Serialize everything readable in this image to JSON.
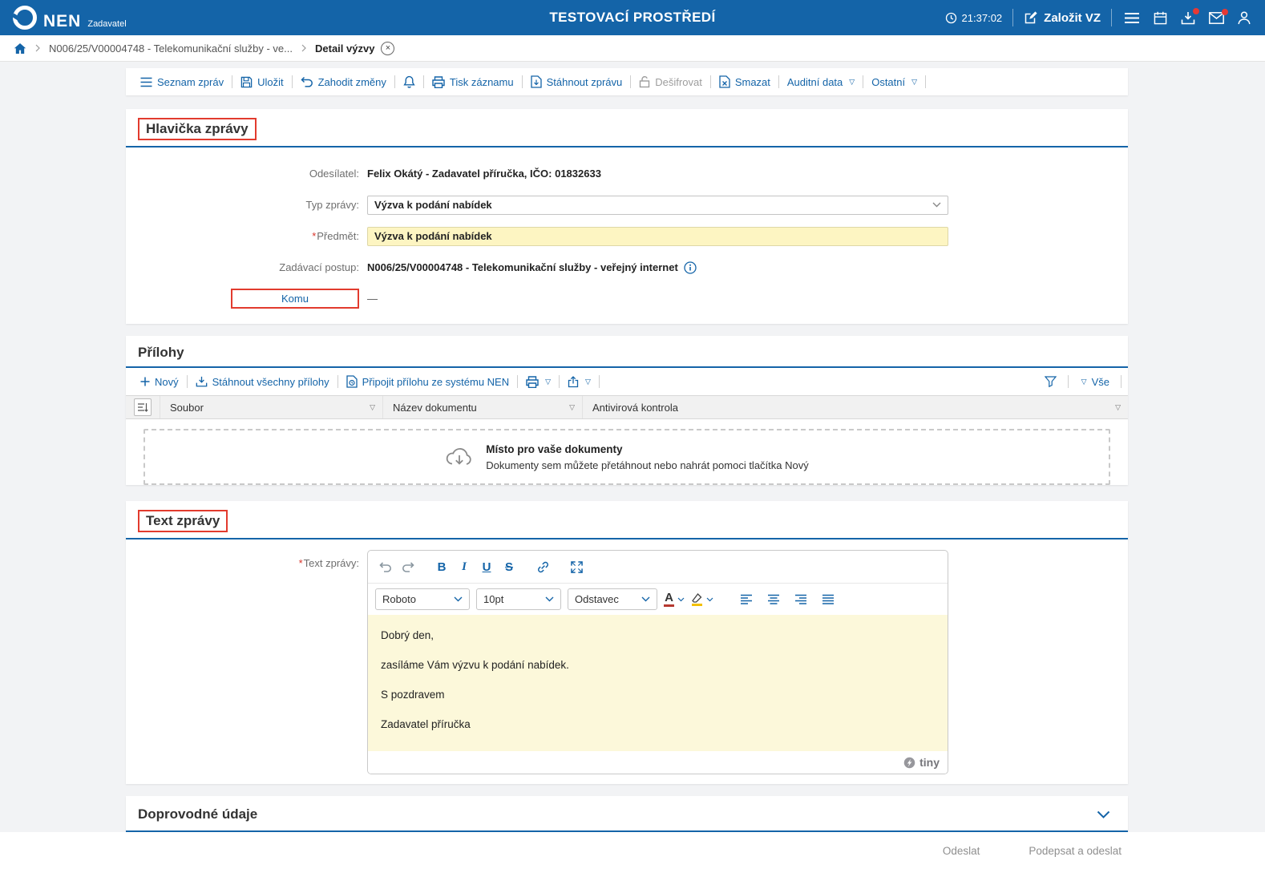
{
  "required_mark": "*",
  "icons": {
    "filter_dropdown": "▽",
    "close": "×",
    "bold": "B",
    "italic": "I",
    "underline": "U",
    "strikethrough": "S",
    "text_color": "A"
  },
  "header": {
    "brand": "NEN",
    "brand_sub": "Zadavatel",
    "environment_title": "TESTOVACÍ PROSTŘEDÍ",
    "time": "21:37:02",
    "create_vz_label": "Založit VZ"
  },
  "breadcrumb": {
    "procedure": "N006/25/V00004748 - Telekomunikační služby - ve...",
    "current": "Detail výzvy"
  },
  "toolbar": {
    "items": [
      {
        "label": "Seznam zpráv"
      },
      {
        "label": "Uložit"
      },
      {
        "label": "Zahodit změny"
      },
      {
        "label": "Tisk záznamu"
      },
      {
        "label": "Stáhnout zprávu"
      },
      {
        "label": "Dešifrovat"
      },
      {
        "label": "Smazat"
      },
      {
        "label": "Auditní data"
      },
      {
        "label": "Ostatní"
      }
    ]
  },
  "message_header": {
    "title": "Hlavička zprávy",
    "sender_label": "Odesílatel:",
    "sender_value": "Felix Okátý - Zadavatel příručka, IČO: 01832633",
    "type_label": "Typ zprávy:",
    "type_value": "Výzva k podání nabídek",
    "subject_label": "Předmět:",
    "subject_value": "Výzva k podání nabídek",
    "procedure_label": "Zadávací postup:",
    "procedure_value": "N006/25/V00004748 - Telekomunikační služby - veřejný internet",
    "to_label": "Komu",
    "to_value": "—"
  },
  "attachments": {
    "title": "Přílohy",
    "new_label": "Nový",
    "download_all_label": "Stáhnout všechny přílohy",
    "attach_from_nen_label": "Připojit přílohu ze systému NEN",
    "filter_all_label": "Vše",
    "columns": [
      {
        "label": "Soubor"
      },
      {
        "label": "Název dokumentu"
      },
      {
        "label": "Antivirová kontrola"
      }
    ],
    "empty_title": "Místo pro vaše dokumenty",
    "empty_hint": "Dokumenty sem můžete přetáhnout nebo nahrát pomoci tlačítka Nový"
  },
  "message_body": {
    "title": "Text zprávy",
    "field_label": "Text zprávy:",
    "editor": {
      "font_name": "Roboto",
      "font_size": "10pt",
      "block_format": "Odstavec",
      "paragraphs": [
        "Dobrý den,",
        "zasíláme Vám výzvu k podání nabídek.",
        "S pozdravem",
        "Zadavatel příručka"
      ],
      "brand": "tiny"
    }
  },
  "additional_info": {
    "title": "Doprovodné údaje"
  },
  "footer": {
    "send_label": "Odeslat",
    "sign_send_label": "Podepsat a odeslat"
  }
}
